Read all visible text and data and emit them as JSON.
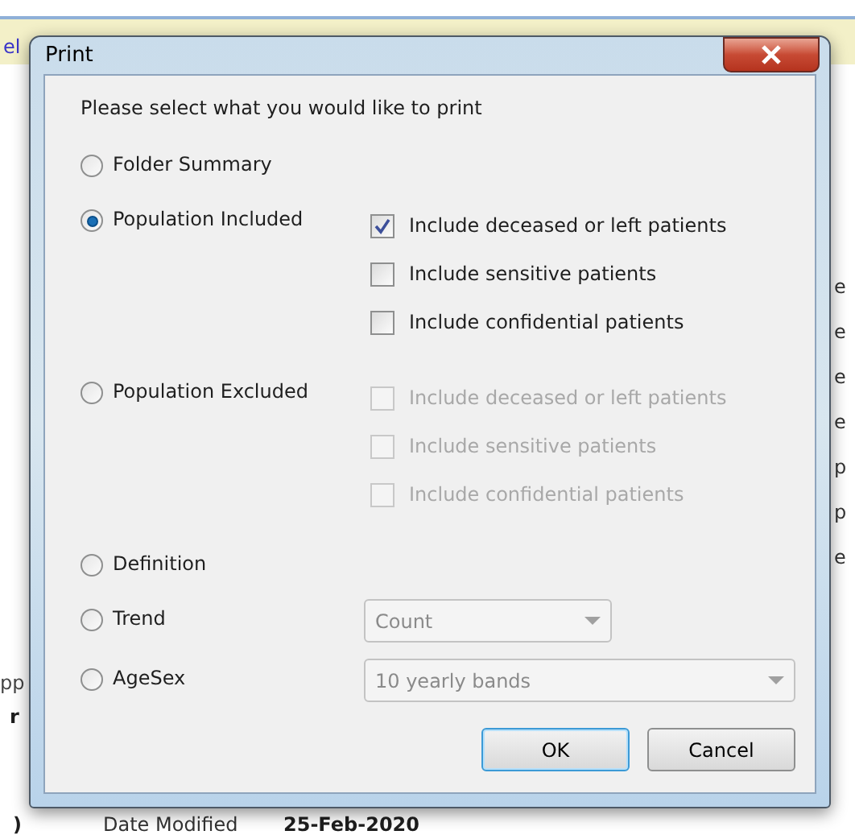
{
  "background": {
    "left_fragments": [
      {
        "text": "el",
        "bold": false
      },
      {
        "text": "pp",
        "bold": false
      },
      {
        "text": "r",
        "bold": true
      }
    ],
    "right_fragments": [
      "e",
      "e",
      "e",
      "e",
      "p",
      "p",
      "e"
    ],
    "footer": {
      "lead": ")",
      "label": "Date Modified",
      "value": "25-Feb-2020"
    }
  },
  "dialog": {
    "title": "Print",
    "prompt": "Please select what you would like to print",
    "options": [
      {
        "label": "Folder Summary",
        "selected": false
      },
      {
        "label": "Population Included",
        "selected": true,
        "checkboxes": [
          {
            "label": "Include deceased or left patients",
            "checked": true,
            "disabled": false
          },
          {
            "label": "Include sensitive patients",
            "checked": false,
            "disabled": false
          },
          {
            "label": "Include confidential patients",
            "checked": false,
            "disabled": false
          }
        ]
      },
      {
        "label": "Population Excluded",
        "selected": false,
        "checkboxes": [
          {
            "label": "Include deceased or left patients",
            "checked": false,
            "disabled": true
          },
          {
            "label": "Include sensitive patients",
            "checked": false,
            "disabled": true
          },
          {
            "label": "Include confidential patients",
            "checked": false,
            "disabled": true
          }
        ]
      },
      {
        "label": "Definition",
        "selected": false
      },
      {
        "label": "Trend",
        "selected": false,
        "dropdown": {
          "value": "Count",
          "disabled": true,
          "wide": false
        }
      },
      {
        "label": "AgeSex",
        "selected": false,
        "dropdown": {
          "value": "10 yearly bands",
          "disabled": true,
          "wide": true
        }
      }
    ],
    "buttons": [
      {
        "label": "OK",
        "default": true
      },
      {
        "label": "Cancel",
        "default": false
      }
    ]
  }
}
